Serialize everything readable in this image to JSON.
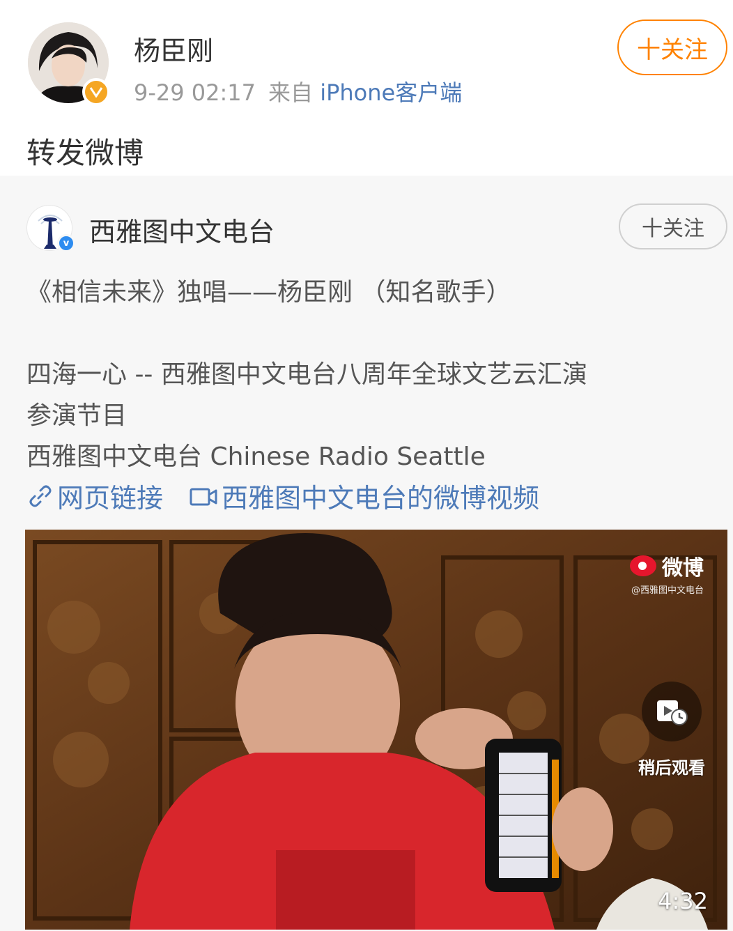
{
  "post": {
    "author": "杨臣刚",
    "timestamp": "9-29 02:17",
    "from_label": "来自",
    "source": "iPhone客户端",
    "follow_label": "十关注",
    "text": "转发微博"
  },
  "quoted": {
    "author": "西雅图中文电台",
    "follow_label": "十关注",
    "lines": [
      "《相信未来》独唱——杨臣刚 （知名歌手）",
      "四海一心 -- 西雅图中文电台八周年全球文艺云汇演",
      "参演节目",
      "西雅图中文电台 Chinese Radio Seattle"
    ],
    "links": {
      "web_link": "网页链接",
      "video_link": "西雅图中文电台的微博视频"
    },
    "video": {
      "watermark_brand": "微博",
      "watermark_handle": "@西雅图中文电台",
      "watch_later_label": "稍后观看",
      "duration": "4:32"
    }
  },
  "colors": {
    "accent_orange": "#ff8200",
    "link_blue": "#4d7ab8",
    "verified_gold": "#f5a623",
    "verified_blue": "#2d8cf0"
  }
}
